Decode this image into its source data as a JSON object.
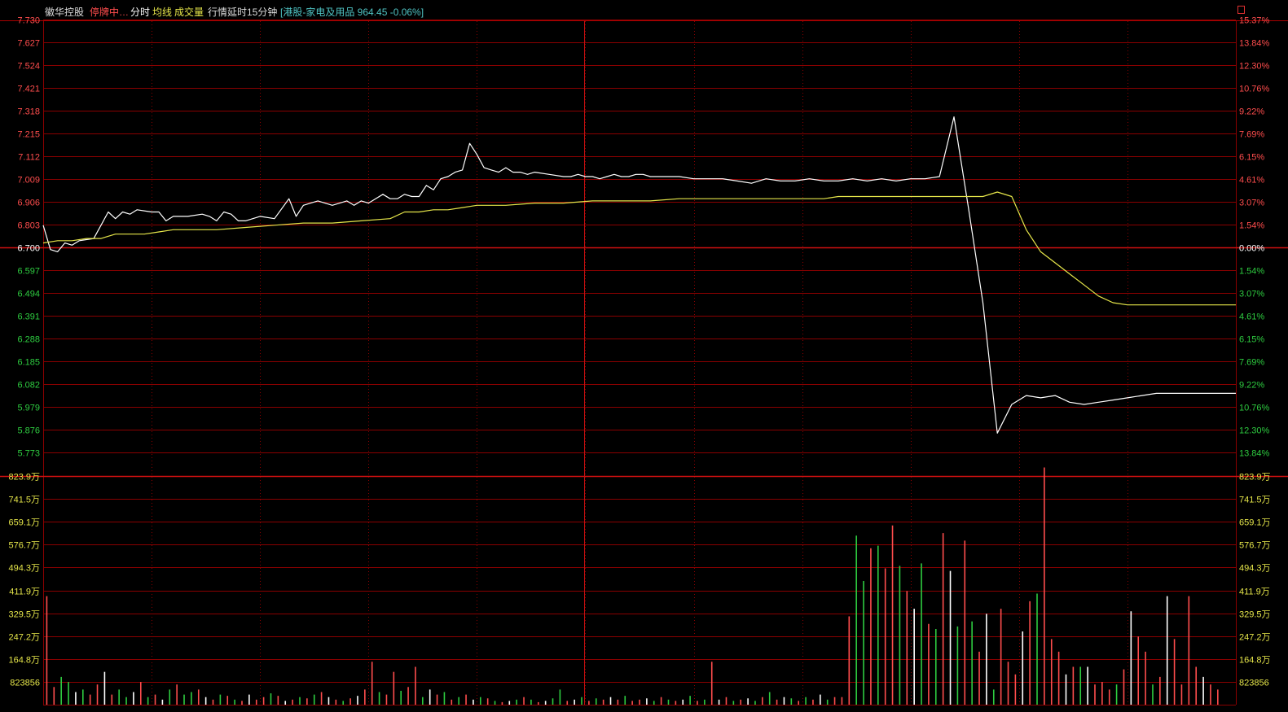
{
  "header": {
    "stock_name": "徽华控股",
    "status": "停牌中…",
    "tab_fenshi": "分时",
    "tab_junxian": "均线",
    "tab_volume": "成交量",
    "delay_note": "行情延时15分钟",
    "index_info": "[港股-家电及用品 964.45 -0.06%]"
  },
  "colors": {
    "background": "#000000",
    "grid": "#8a0000",
    "price_line": "#ffffff",
    "avg_line": "#e6e64a",
    "up": "#ff4d4d",
    "down": "#2ecc40",
    "neutral_volume": "#ffffff"
  },
  "chart_data": [
    {
      "type": "line",
      "name": "price",
      "y_labels_left": [
        "7.730",
        "7.627",
        "7.524",
        "7.421",
        "7.318",
        "7.215",
        "7.112",
        "7.009",
        "6.906",
        "6.803",
        "6.700",
        "6.597",
        "6.494",
        "6.391",
        "6.288",
        "6.185",
        "6.082",
        "5.979",
        "5.876",
        "5.773"
      ],
      "y_labels_right": [
        "15.37%",
        "13.84%",
        "12.30%",
        "10.76%",
        "9.22%",
        "7.69%",
        "6.15%",
        "4.61%",
        "3.07%",
        "1.54%",
        "0.00%",
        "1.54%",
        "3.07%",
        "4.61%",
        "6.15%",
        "7.69%",
        "9.22%",
        "10.76%",
        "12.30%",
        "13.84%"
      ],
      "ylim": [
        5.773,
        7.73
      ],
      "prev_close": 6.7,
      "xlim": [
        0,
        330
      ],
      "series": [
        {
          "x": [
            0,
            2,
            4,
            6,
            8,
            10,
            14,
            18,
            20,
            22,
            24,
            26,
            30,
            32,
            34,
            36,
            40,
            44,
            46,
            48,
            50,
            52,
            54,
            56,
            60,
            64,
            68,
            70,
            72,
            74,
            76,
            80,
            84,
            86,
            88,
            90,
            92,
            94,
            96,
            98,
            100,
            102,
            104,
            106,
            108,
            110,
            112,
            114,
            116,
            118,
            120,
            122,
            124,
            126,
            128,
            130,
            132,
            134,
            136,
            140,
            144,
            146,
            148,
            150,
            152,
            154,
            156,
            158,
            160,
            162,
            164,
            166,
            168,
            170,
            172,
            176,
            180,
            184,
            188,
            192,
            196,
            200,
            204,
            208,
            212,
            216,
            220,
            224,
            228,
            232,
            236,
            240,
            244,
            248,
            252,
            256,
            260,
            264,
            268,
            272,
            276,
            280,
            284,
            288,
            292,
            296,
            300,
            304,
            308,
            312,
            330
          ],
          "values": [
            6.8,
            6.69,
            6.68,
            6.72,
            6.71,
            6.73,
            6.74,
            6.86,
            6.83,
            6.86,
            6.85,
            6.87,
            6.86,
            6.86,
            6.82,
            6.84,
            6.84,
            6.85,
            6.84,
            6.82,
            6.86,
            6.85,
            6.82,
            6.82,
            6.84,
            6.83,
            6.92,
            6.84,
            6.89,
            6.9,
            6.91,
            6.89,
            6.91,
            6.89,
            6.91,
            6.9,
            6.92,
            6.94,
            6.92,
            6.92,
            6.94,
            6.93,
            6.93,
            6.98,
            6.96,
            7.01,
            7.02,
            7.04,
            7.05,
            7.17,
            7.12,
            7.06,
            7.05,
            7.04,
            7.06,
            7.04,
            7.04,
            7.03,
            7.04,
            7.03,
            7.02,
            7.02,
            7.03,
            7.02,
            7.02,
            7.01,
            7.02,
            7.03,
            7.02,
            7.02,
            7.03,
            7.03,
            7.02,
            7.02,
            7.02,
            7.02,
            7.01,
            7.01,
            7.01,
            7.0,
            6.99,
            7.01,
            7.0,
            7.0,
            7.01,
            7.0,
            7.0,
            7.01,
            7.0,
            7.01,
            7.0,
            7.01,
            7.01,
            7.02,
            7.29,
            6.88,
            6.45,
            5.86,
            5.99,
            6.03,
            6.02,
            6.03,
            6.0,
            5.99,
            6.0,
            6.01,
            6.02,
            6.03,
            6.04,
            6.04,
            6.04
          ]
        },
        {
          "x": [
            0,
            4,
            8,
            12,
            16,
            20,
            24,
            28,
            32,
            36,
            40,
            48,
            56,
            64,
            72,
            80,
            88,
            96,
            100,
            104,
            108,
            112,
            116,
            120,
            124,
            128,
            136,
            144,
            152,
            160,
            168,
            176,
            184,
            192,
            200,
            208,
            216,
            220,
            224,
            228,
            232,
            236,
            240,
            244,
            248,
            252,
            256,
            260,
            264,
            268,
            272,
            276,
            280,
            284,
            288,
            292,
            296,
            300,
            304,
            308,
            312,
            316,
            320,
            324,
            330
          ],
          "values": [
            6.72,
            6.73,
            6.73,
            6.74,
            6.74,
            6.76,
            6.76,
            6.76,
            6.77,
            6.78,
            6.78,
            6.78,
            6.79,
            6.8,
            6.81,
            6.81,
            6.82,
            6.83,
            6.86,
            6.86,
            6.87,
            6.87,
            6.88,
            6.89,
            6.89,
            6.89,
            6.9,
            6.9,
            6.91,
            6.91,
            6.91,
            6.92,
            6.92,
            6.92,
            6.92,
            6.92,
            6.92,
            6.93,
            6.93,
            6.93,
            6.93,
            6.93,
            6.93,
            6.93,
            6.93,
            6.93,
            6.93,
            6.93,
            6.95,
            6.93,
            6.78,
            6.68,
            6.63,
            6.58,
            6.53,
            6.48,
            6.45,
            6.44,
            6.44,
            6.44,
            6.44,
            6.44,
            6.44,
            6.44,
            6.44
          ]
        }
      ]
    },
    {
      "type": "bar",
      "name": "volume",
      "y_labels": [
        "823.9万",
        "741.5万",
        "659.1万",
        "576.7万",
        "494.3万",
        "411.9万",
        "329.5万",
        "247.2万",
        "164.8万",
        "823856"
      ],
      "ylim": [
        0,
        9060000
      ],
      "xlim": [
        0,
        330
      ],
      "x": [
        1,
        3,
        5,
        7,
        9,
        11,
        13,
        15,
        17,
        19,
        21,
        23,
        25,
        27,
        29,
        31,
        33,
        35,
        37,
        39,
        41,
        43,
        45,
        47,
        49,
        51,
        53,
        55,
        57,
        59,
        61,
        63,
        65,
        67,
        69,
        71,
        73,
        75,
        77,
        79,
        81,
        83,
        85,
        87,
        89,
        91,
        93,
        95,
        97,
        99,
        101,
        103,
        105,
        107,
        109,
        111,
        113,
        115,
        117,
        119,
        121,
        123,
        125,
        127,
        129,
        131,
        133,
        135,
        137,
        139,
        141,
        143,
        145,
        147,
        149,
        151,
        153,
        155,
        157,
        159,
        161,
        163,
        165,
        167,
        169,
        171,
        173,
        175,
        177,
        179,
        181,
        183,
        185,
        187,
        189,
        191,
        193,
        195,
        197,
        199,
        201,
        203,
        205,
        207,
        209,
        211,
        213,
        215,
        217,
        219,
        221,
        223,
        225,
        227,
        229,
        231,
        233,
        235,
        237,
        239,
        241,
        243,
        245,
        247,
        249,
        251,
        253,
        255,
        257,
        259,
        261,
        263,
        265,
        267,
        269,
        271,
        273,
        275,
        277,
        279,
        281,
        283,
        285,
        287,
        289,
        291,
        293,
        295,
        297,
        299,
        301,
        303,
        305,
        307,
        309,
        311,
        313,
        315,
        317,
        319,
        321,
        323,
        325,
        327,
        329
      ],
      "values": [
        4300000,
        700000,
        1100000,
        900000,
        500000,
        600000,
        400000,
        800000,
        1300000,
        400000,
        600000,
        300000,
        500000,
        900000,
        300000,
        400000,
        200000,
        600000,
        800000,
        400000,
        500000,
        600000,
        300000,
        200000,
        400000,
        350000,
        200000,
        150000,
        400000,
        200000,
        300000,
        450000,
        350000,
        150000,
        200000,
        300000,
        250000,
        400000,
        500000,
        300000,
        200000,
        150000,
        250000,
        350000,
        600000,
        1700000,
        500000,
        400000,
        1300000,
        550000,
        700000,
        1500000,
        300000,
        600000,
        400000,
        500000,
        200000,
        300000,
        400000,
        200000,
        300000,
        250000,
        150000,
        100000,
        150000,
        200000,
        300000,
        200000,
        100000,
        150000,
        250000,
        600000,
        150000,
        200000,
        300000,
        150000,
        250000,
        200000,
        300000,
        200000,
        350000,
        150000,
        200000,
        250000,
        150000,
        300000,
        200000,
        150000,
        200000,
        350000,
        150000,
        200000,
        1700000,
        200000,
        300000,
        150000,
        200000,
        250000,
        150000,
        300000,
        500000,
        200000,
        300000,
        250000,
        150000,
        300000,
        200000,
        400000,
        200000,
        300000,
        300000,
        3500000,
        6700000,
        4900000,
        6200000,
        6300000,
        5400000,
        7100000,
        5500000,
        4500000,
        3800000,
        5600000,
        3200000,
        3000000,
        6800000,
        5300000,
        3100000,
        6500000,
        3300000,
        2100000,
        3600000,
        600000,
        3800000,
        1700000,
        1200000,
        2900000,
        4100000,
        4400000,
        9400000,
        2600000,
        2100000,
        1200000,
        1500000,
        1500000,
        1500000,
        800000,
        900000,
        600000,
        800000,
        1400000,
        3700000,
        2700000,
        2100000,
        800000,
        1100000,
        4300000,
        2600000,
        800000,
        4300000,
        1500000,
        1100000,
        800000,
        600000
      ],
      "colors": [
        "up",
        "up",
        "down",
        "down",
        "neutral_volume",
        "down",
        "up",
        "up",
        "neutral_volume",
        "up",
        "down",
        "down",
        "neutral_volume",
        "up",
        "down",
        "up",
        "neutral_volume",
        "down",
        "up",
        "down",
        "down",
        "up",
        "neutral_volume",
        "up",
        "down",
        "up",
        "down",
        "up",
        "neutral_volume",
        "up",
        "up",
        "down",
        "up",
        "neutral_volume",
        "up",
        "down",
        "up",
        "down",
        "up",
        "neutral_volume",
        "up",
        "down",
        "up",
        "neutral_volume",
        "up",
        "up",
        "down",
        "up",
        "up",
        "down",
        "up",
        "up",
        "down",
        "neutral_volume",
        "up",
        "down",
        "up",
        "down",
        "up",
        "neutral_volume",
        "down",
        "up",
        "down",
        "up",
        "neutral_volume",
        "down",
        "up",
        "down",
        "up",
        "neutral_volume",
        "down",
        "down",
        "up",
        "neutral_volume",
        "down",
        "up",
        "down",
        "up",
        "neutral_volume",
        "up",
        "down",
        "up",
        "up",
        "neutral_volume",
        "down",
        "up",
        "down",
        "up",
        "neutral_volume",
        "down",
        "up",
        "down",
        "up",
        "neutral_volume",
        "up",
        "down",
        "up",
        "neutral_volume",
        "down",
        "up",
        "down",
        "up",
        "neutral_volume",
        "down",
        "up",
        "down",
        "up",
        "neutral_volume",
        "down",
        "up",
        "up",
        "up",
        "down",
        "down",
        "up",
        "down",
        "up",
        "up",
        "down",
        "up",
        "neutral_volume",
        "down",
        "up",
        "down",
        "up",
        "neutral_volume",
        "down",
        "up",
        "down",
        "up",
        "neutral_volume",
        "down",
        "up",
        "up",
        "up",
        "neutral_volume",
        "up",
        "down",
        "up",
        "up",
        "up",
        "neutral_volume",
        "up",
        "down",
        "neutral_volume",
        "up",
        "up",
        "up",
        "down",
        "up",
        "neutral_volume",
        "up",
        "up",
        "down",
        "up",
        "neutral_volume",
        "up",
        "up",
        "up",
        "up",
        "neutral_volume",
        "up",
        "up",
        "neutral_volume",
        "neutral_volume",
        "neutral_volume"
      ]
    }
  ]
}
